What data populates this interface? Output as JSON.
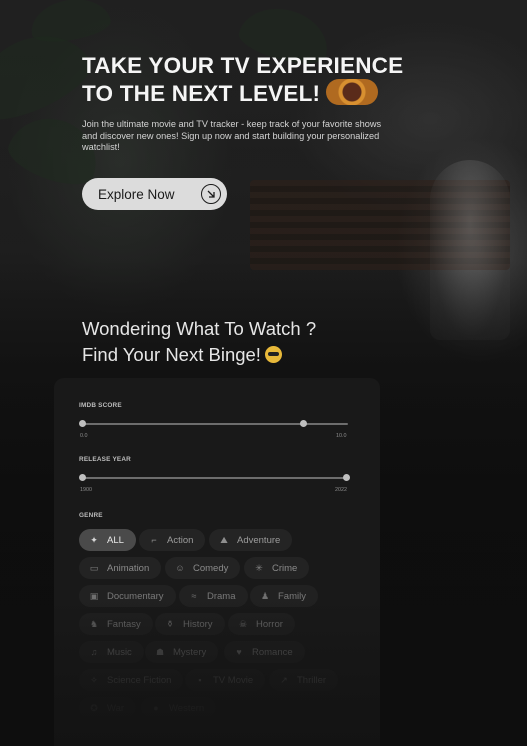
{
  "hero": {
    "title_line1": "TAKE YOUR TV EXPERIENCE",
    "title_line2": "TO THE NEXT LEVEL!",
    "description": "Join the ultimate movie and TV tracker - keep track of your favorite shows and discover new ones! Sign up now and start building your personalized watchlist!",
    "cta_label": "Explore Now",
    "cta_icon": "arrow-down-right-icon"
  },
  "discover": {
    "title_line1": "Wondering What To Watch ?",
    "title_line2": "Find Your Next Binge!",
    "title_emoji": "sunglasses-emoji"
  },
  "filters": {
    "imdb": {
      "label": "IMDB SCORE",
      "min_label": "0.0",
      "max_label": "10.0",
      "range": [
        0,
        0.9
      ]
    },
    "year": {
      "label": "RELEASE YEAR",
      "min_label": "1900",
      "max_label": "2022",
      "range": [
        0,
        1
      ]
    },
    "genre": {
      "label": "GENRE",
      "chips": [
        {
          "label": "ALL",
          "icon": "sparkles-icon",
          "active": true
        },
        {
          "label": "Action",
          "icon": "gun-icon"
        },
        {
          "label": "Adventure",
          "icon": "hiking-icon"
        },
        {
          "label": "Animation",
          "icon": "animation-icon"
        },
        {
          "label": "Comedy",
          "icon": "comedy-icon"
        },
        {
          "label": "Crime",
          "icon": "crime-icon"
        },
        {
          "label": "Documentary",
          "icon": "documentary-icon"
        },
        {
          "label": "Drama",
          "icon": "drama-icon"
        },
        {
          "label": "Family",
          "icon": "family-icon"
        },
        {
          "label": "Fantasy",
          "icon": "fantasy-icon"
        },
        {
          "label": "History",
          "icon": "history-icon"
        },
        {
          "label": "Horror",
          "icon": "horror-icon"
        },
        {
          "label": "Music",
          "icon": "music-icon"
        },
        {
          "label": "Mystery",
          "icon": "mystery-icon"
        },
        {
          "label": "Romance",
          "icon": "heart-icon"
        },
        {
          "label": "Science Fiction",
          "icon": "scifi-icon"
        },
        {
          "label": "TV Movie",
          "icon": "tv-icon"
        },
        {
          "label": "Thriller",
          "icon": "thriller-icon"
        },
        {
          "label": "War",
          "icon": "war-icon"
        },
        {
          "label": "Western",
          "icon": "western-icon"
        }
      ]
    }
  }
}
